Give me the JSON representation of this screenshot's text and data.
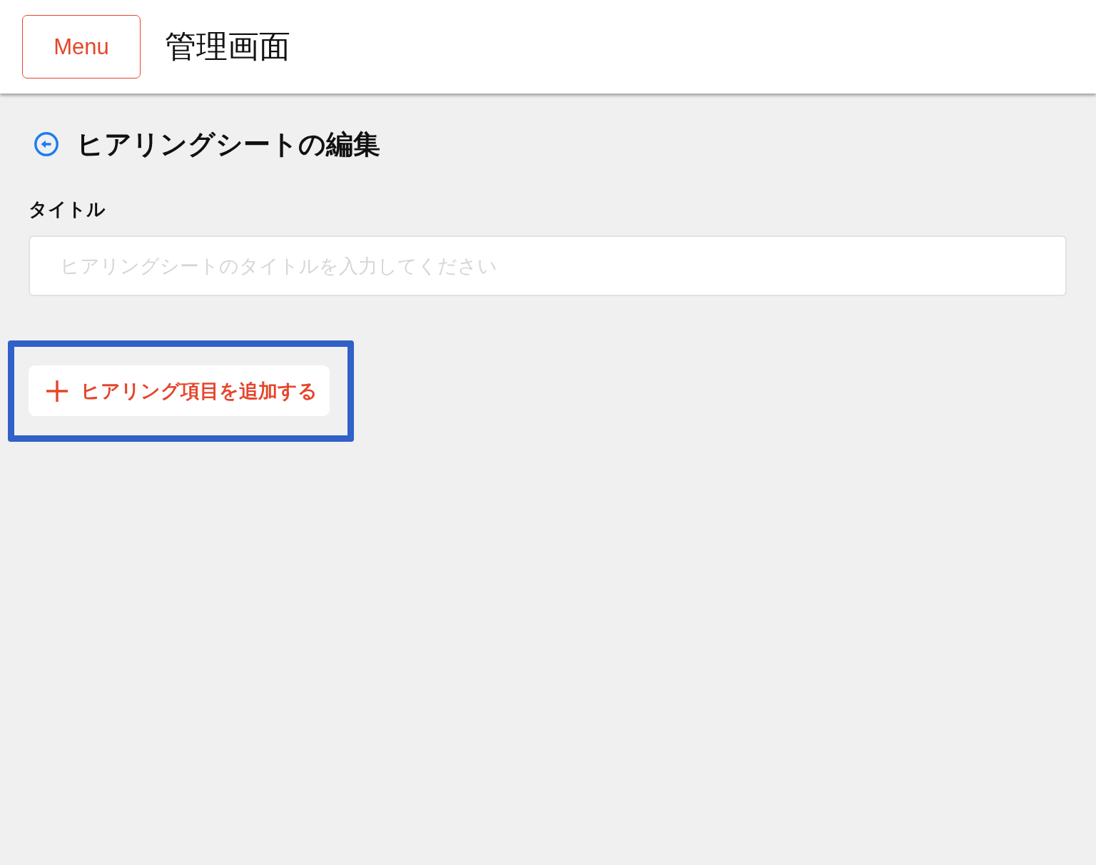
{
  "header": {
    "menu_button": "Menu",
    "title": "管理画面"
  },
  "page_heading": {
    "title": "ヒアリングシートの編集"
  },
  "form": {
    "fields": [
      {
        "label": "タイトル",
        "placeholder": "ヒアリングシートのタイトルを入力してください"
      }
    ]
  },
  "add_item_button": {
    "label": "ヒアリング項目を追加する",
    "highlighted": true
  }
}
